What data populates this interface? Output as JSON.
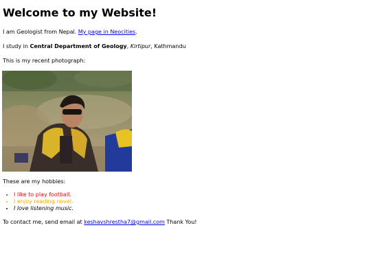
{
  "page": {
    "title": "Welcome to my Website!",
    "intro": {
      "text": "I am Geologist from Nepal.",
      "link_label": "My page in Neocities",
      "after": "."
    },
    "study": {
      "prefix": "I study in",
      "department": "Central Department of Geology",
      "sep1": ",",
      "place": "Kirtipur",
      "sep2": ", Kathmandu"
    },
    "photo_caption": "This is my recent photograph:",
    "hobbies_heading": "These are my hobbies:",
    "hobbies": [
      {
        "text": "I like to play football.",
        "color": "#ff0000"
      },
      {
        "text": "I enjoy reading novel.",
        "color": "#ffa500"
      },
      {
        "text": "I love listening music.",
        "color": "#000000"
      }
    ],
    "contact": {
      "prefix": "To contact me, send email at",
      "email": "keshavshrestha7@gmail.com",
      "suffix": "Thank You!"
    }
  },
  "colors": {
    "link": "#0000ee",
    "hobby_1": "#ff0000",
    "hobby_2": "#ffa500"
  }
}
